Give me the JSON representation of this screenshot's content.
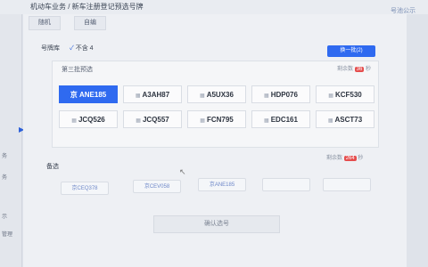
{
  "header": {
    "breadcrumb": "机动车业务 / 新车注册登记预选号牌",
    "right_link": "号池公示"
  },
  "sidebar": {
    "snips": [
      "务",
      "务",
      "示",
      "管理"
    ]
  },
  "tabs": [
    "随机",
    "自编"
  ],
  "pool": {
    "label": "号牌库",
    "check": "✓",
    "check_label": "不含 4",
    "next_button": "换一批(2)"
  },
  "group": {
    "title": "第三批预选",
    "timer_label": "剩余数",
    "timer_value": "36",
    "timer_unit": "秒"
  },
  "plates": [
    {
      "text": "京 ANE185",
      "selected": true
    },
    {
      "text": "A3AH87",
      "selected": false
    },
    {
      "text": "A5UX36",
      "selected": false
    },
    {
      "text": "HDP076",
      "selected": false
    },
    {
      "text": "KCF530",
      "selected": false
    },
    {
      "text": "JCQ526",
      "selected": false
    },
    {
      "text": "JCQ557",
      "selected": false
    },
    {
      "text": "FCN795",
      "selected": false
    },
    {
      "text": "EDC161",
      "selected": false
    },
    {
      "text": "ASCT73",
      "selected": false
    }
  ],
  "backup": {
    "label": "备选",
    "timer_label": "剩余数",
    "timer_value": "264",
    "timer_unit": "秒",
    "items": [
      "京CEQ378",
      "京CEV058",
      "京ANE185"
    ]
  },
  "confirm_label": "确认选号",
  "colors": {
    "primary": "#2f6af0",
    "alert": "#e54d4d"
  }
}
